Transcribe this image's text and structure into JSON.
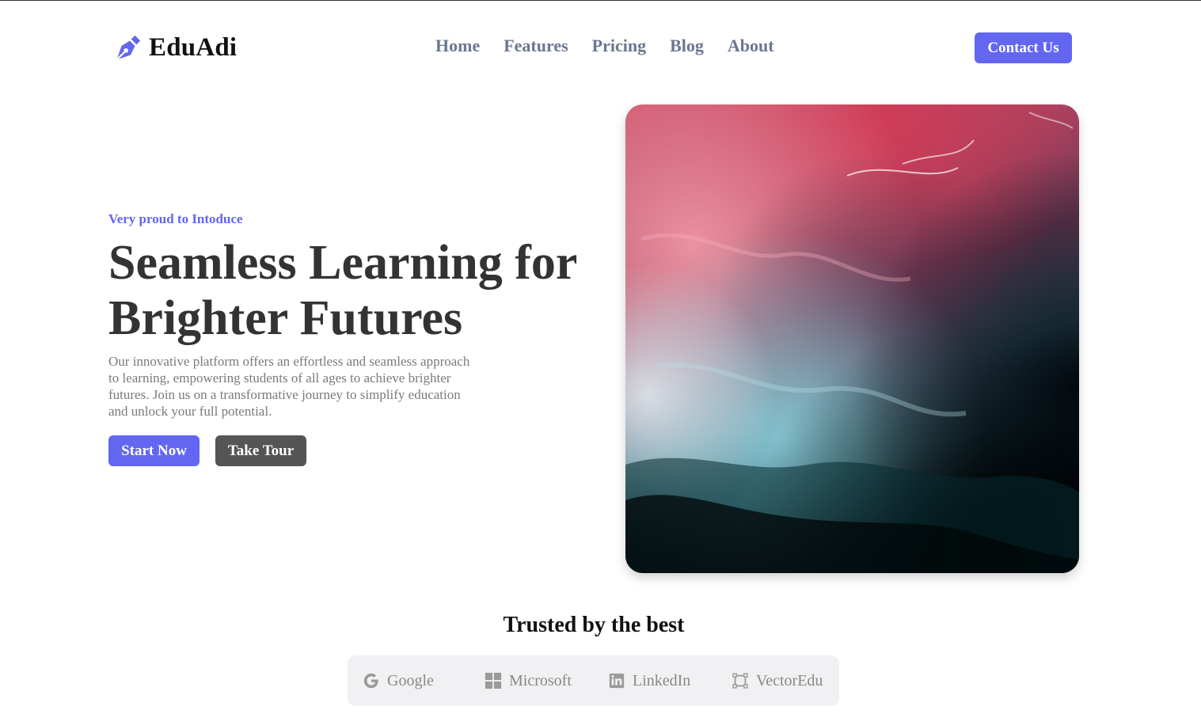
{
  "brand": {
    "name": "EduAdi",
    "icon": "pen-nib-icon",
    "accent": "#6366f1"
  },
  "nav": {
    "items": [
      {
        "label": "Home"
      },
      {
        "label": "Features"
      },
      {
        "label": "Pricing"
      },
      {
        "label": "Blog"
      },
      {
        "label": "About"
      }
    ]
  },
  "header": {
    "contact_label": "Contact Us"
  },
  "hero": {
    "eyebrow": "Very proud to Intoduce",
    "title_line1": "Seamless Learning for",
    "title_line2": "Brighter Futures",
    "description": "Our innovative platform offers an effortless and seamless approach to learning, empowering students of all ages to achieve brighter futures. Join us on a transformative journey to simplify education and unlock your full potential.",
    "start_label": "Start Now",
    "tour_label": "Take Tour"
  },
  "trusted": {
    "title": "Trusted by the best",
    "logos": [
      {
        "name": "Google",
        "icon": "google-icon"
      },
      {
        "name": "Microsoft",
        "icon": "microsoft-icon"
      },
      {
        "name": "LinkedIn",
        "icon": "linkedin-icon"
      },
      {
        "name": "VectorEdu",
        "icon": "vector-square-icon"
      }
    ]
  },
  "colors": {
    "primary": "#6366f1",
    "secondary_button": "#555555",
    "nav_text": "#6b7690",
    "logo_strip_bg": "#f1f1f3"
  }
}
